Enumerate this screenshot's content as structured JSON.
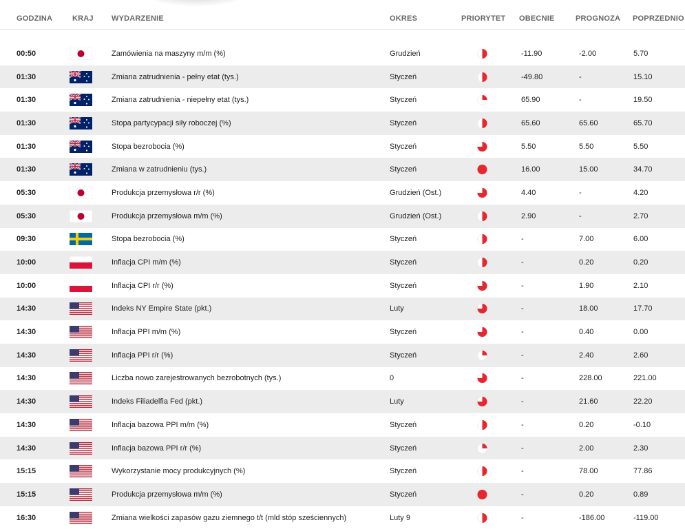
{
  "header": {
    "time": "GODZINA",
    "country": "KRAJ",
    "event": "WYDARZENIE",
    "period": "OKRES",
    "priority": "PRIORYTET",
    "actual": "OBECNIE",
    "forecast": "PROGNOZA",
    "previous": "POPRZEDNIO"
  },
  "colors": {
    "priority_red": "#e8262f",
    "row_alt": "#ececec",
    "header_text": "#666666"
  },
  "rows": [
    {
      "time": "00:50",
      "flag": "japan-flag-icon",
      "event": "Zamówienia na maszyny m/m (%)",
      "period": "Grudzień",
      "priority": 0.5,
      "actual": "-11.90",
      "forecast": "-2.00",
      "previous": "5.70"
    },
    {
      "time": "01:30",
      "flag": "australia-flag-icon",
      "event": "Zmiana zatrudnienia - pełny etat (tys.)",
      "period": "Styczeń",
      "priority": 0.5,
      "actual": "-49.80",
      "forecast": "-",
      "previous": "15.10"
    },
    {
      "time": "01:30",
      "flag": "australia-flag-icon",
      "event": "Zmiana zatrudnienia - niepełny etat (tys.)",
      "period": "Styczeń",
      "priority": 0.25,
      "actual": "65.90",
      "forecast": "-",
      "previous": "19.50"
    },
    {
      "time": "01:30",
      "flag": "australia-flag-icon",
      "event": "Stopa partycypacji siły roboczej (%)",
      "period": "Styczeń",
      "priority": 0.5,
      "actual": "65.60",
      "forecast": "65.60",
      "previous": "65.70"
    },
    {
      "time": "01:30",
      "flag": "australia-flag-icon",
      "event": "Stopa bezrobocia (%)",
      "period": "Styczeń",
      "priority": 0.75,
      "actual": "5.50",
      "forecast": "5.50",
      "previous": "5.50"
    },
    {
      "time": "01:30",
      "flag": "australia-flag-icon",
      "event": "Zmiana w zatrudnieniu (tys.)",
      "period": "Styczeń",
      "priority": 1,
      "actual": "16.00",
      "forecast": "15.00",
      "previous": "34.70"
    },
    {
      "time": "05:30",
      "flag": "japan-flag-icon",
      "event": "Produkcja przemysłowa r/r (%)",
      "period": "Grudzień (Ost.)",
      "priority": 0.75,
      "actual": "4.40",
      "forecast": "-",
      "previous": "4.20"
    },
    {
      "time": "05:30",
      "flag": "japan-flag-icon",
      "event": "Produkcja przemysłowa m/m (%)",
      "period": "Grudzień (Ost.)",
      "priority": 0.5,
      "actual": "2.90",
      "forecast": "-",
      "previous": "2.70"
    },
    {
      "time": "09:30",
      "flag": "sweden-flag-icon",
      "event": "Stopa bezrobocia (%)",
      "period": "Styczeń",
      "priority": 0.5,
      "actual": "-",
      "forecast": "7.00",
      "previous": "6.00"
    },
    {
      "time": "10:00",
      "flag": "poland-flag-icon",
      "event": "Inflacja CPI m/m (%)",
      "period": "Styczeń",
      "priority": 0.5,
      "actual": "-",
      "forecast": "0.20",
      "previous": "0.20"
    },
    {
      "time": "10:00",
      "flag": "poland-flag-icon",
      "event": "Inflacja CPI r/r (%)",
      "period": "Styczeń",
      "priority": 0.75,
      "actual": "-",
      "forecast": "1.90",
      "previous": "2.10"
    },
    {
      "time": "14:30",
      "flag": "usa-flag-icon",
      "event": "Indeks NY Empire State (pkt.)",
      "period": "Luty",
      "priority": 0.75,
      "actual": "-",
      "forecast": "18.00",
      "previous": "17.70"
    },
    {
      "time": "14:30",
      "flag": "usa-flag-icon",
      "event": "Inflacja PPI m/m (%)",
      "period": "Styczeń",
      "priority": 0.75,
      "actual": "-",
      "forecast": "0.40",
      "previous": "0.00"
    },
    {
      "time": "14:30",
      "flag": "usa-flag-icon",
      "event": "Inflacja PPI r/r (%)",
      "period": "Styczeń",
      "priority": 0.25,
      "actual": "-",
      "forecast": "2.40",
      "previous": "2.60"
    },
    {
      "time": "14:30",
      "flag": "usa-flag-icon",
      "event": "Liczba nowo zarejestrowanych bezrobotnych (tys.)",
      "period": "0",
      "priority": 0.75,
      "actual": "-",
      "forecast": "228.00",
      "previous": "221.00"
    },
    {
      "time": "14:30",
      "flag": "usa-flag-icon",
      "event": "Indeks Filiadelfia Fed (pkt.)",
      "period": "Luty",
      "priority": 0.75,
      "actual": "-",
      "forecast": "21.60",
      "previous": "22.20"
    },
    {
      "time": "14:30",
      "flag": "usa-flag-icon",
      "event": "Inflacja bazowa PPI m/m (%)",
      "period": "Styczeń",
      "priority": 0.5,
      "actual": "-",
      "forecast": "0.20",
      "previous": "-0.10"
    },
    {
      "time": "14:30",
      "flag": "usa-flag-icon",
      "event": "Inflacja bazowa PPI r/r (%)",
      "period": "Styczeń",
      "priority": 0.25,
      "actual": "-",
      "forecast": "2.00",
      "previous": "2.30"
    },
    {
      "time": "15:15",
      "flag": "usa-flag-icon",
      "event": "Wykorzystanie mocy produkcyjnych (%)",
      "period": "Styczeń",
      "priority": 0.5,
      "actual": "-",
      "forecast": "78.00",
      "previous": "77.86"
    },
    {
      "time": "15:15",
      "flag": "usa-flag-icon",
      "event": "Produkcja przemysłowa m/m (%)",
      "period": "Styczeń",
      "priority": 1,
      "actual": "-",
      "forecast": "0.20",
      "previous": "0.89"
    },
    {
      "time": "16:30",
      "flag": "usa-flag-icon",
      "event": "Zmiana wielkości zapasów gazu ziemnego t/t (mld stóp sześciennych)",
      "period": "Luty 9",
      "priority": 0.5,
      "actual": "-",
      "forecast": "-186.00",
      "previous": "-119.00"
    }
  ]
}
